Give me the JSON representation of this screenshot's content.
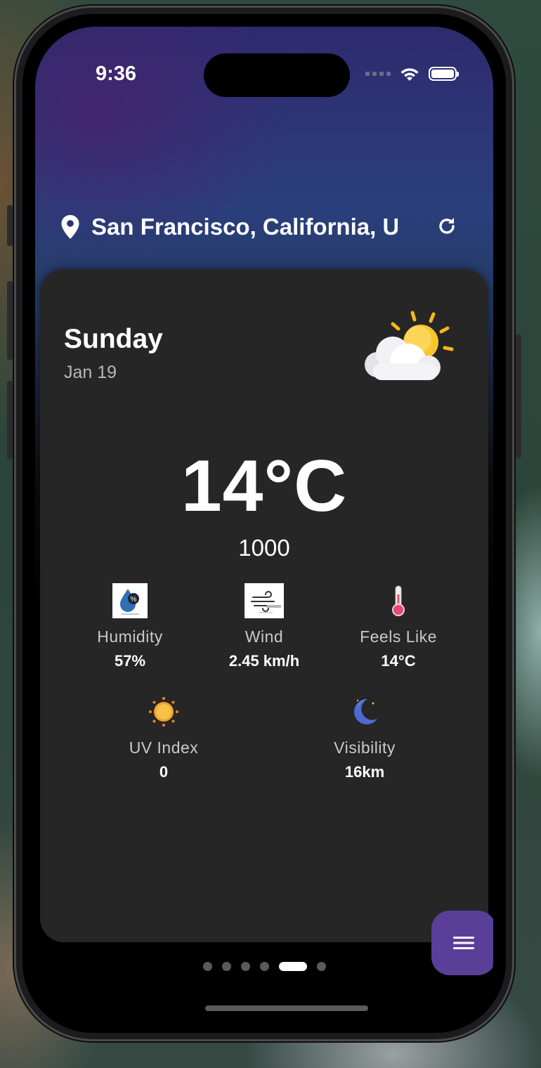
{
  "status_bar": {
    "time": "9:36"
  },
  "location": {
    "name": "San Francisco, California, United States"
  },
  "card": {
    "day": "Sunday",
    "date": "Jan 19",
    "temperature": "14°C",
    "pressure": "1000",
    "condition_icon": "partly-cloudy-icon"
  },
  "metrics": [
    {
      "label": "Humidity",
      "value": "57%",
      "icon": "humidity-icon"
    },
    {
      "label": "Wind",
      "value": "2.45 km/h",
      "icon": "wind-icon"
    },
    {
      "label": "Feels Like",
      "value": "14°C",
      "icon": "thermometer-icon"
    },
    {
      "label": "UV Index",
      "value": "0",
      "icon": "sun-icon"
    },
    {
      "label": "Visibility",
      "value": "16km",
      "icon": "moon-icon"
    }
  ],
  "pager": {
    "total": 6,
    "active_index": 4
  },
  "colors": {
    "fab": "#5a3f99",
    "card": "#262626",
    "accent_gradient_top": "#2e2a6e"
  }
}
